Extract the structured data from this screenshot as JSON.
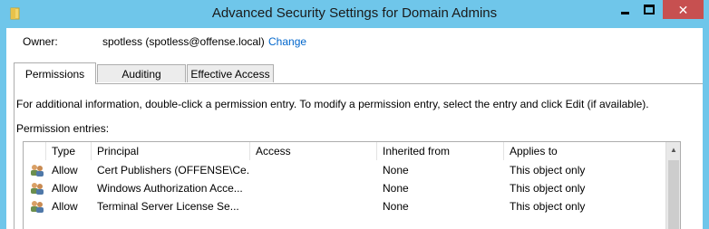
{
  "window": {
    "title": "Advanced Security Settings for Domain Admins",
    "close_glyph": "✕",
    "icon": "folder-icon"
  },
  "owner": {
    "label": "Owner:",
    "value": "spotless (spotless@offense.local)",
    "change_link": "Change"
  },
  "tabs": [
    {
      "label": "Permissions",
      "active": true
    },
    {
      "label": "Auditing",
      "active": false
    },
    {
      "label": "Effective Access",
      "active": false
    }
  ],
  "permissions": {
    "info_text": "For additional information, double-click a permission entry. To modify a permission entry, select the entry and click Edit (if available).",
    "entries_label": "Permission entries:",
    "columns": [
      "Type",
      "Principal",
      "Access",
      "Inherited from",
      "Applies to"
    ],
    "rows": [
      {
        "type": "Allow",
        "principal": "Cert Publishers (OFFENSE\\Ce...",
        "access": "",
        "inherited_from": "None",
        "applies_to": "This object only"
      },
      {
        "type": "Allow",
        "principal": "Windows Authorization Acce...",
        "access": "",
        "inherited_from": "None",
        "applies_to": "This object only"
      },
      {
        "type": "Allow",
        "principal": "Terminal Server License Se...",
        "access": "",
        "inherited_from": "None",
        "applies_to": "This object only"
      }
    ]
  },
  "colors": {
    "titlebar": "#6fc6ea",
    "close_button": "#c75050",
    "link": "#0066cc"
  }
}
